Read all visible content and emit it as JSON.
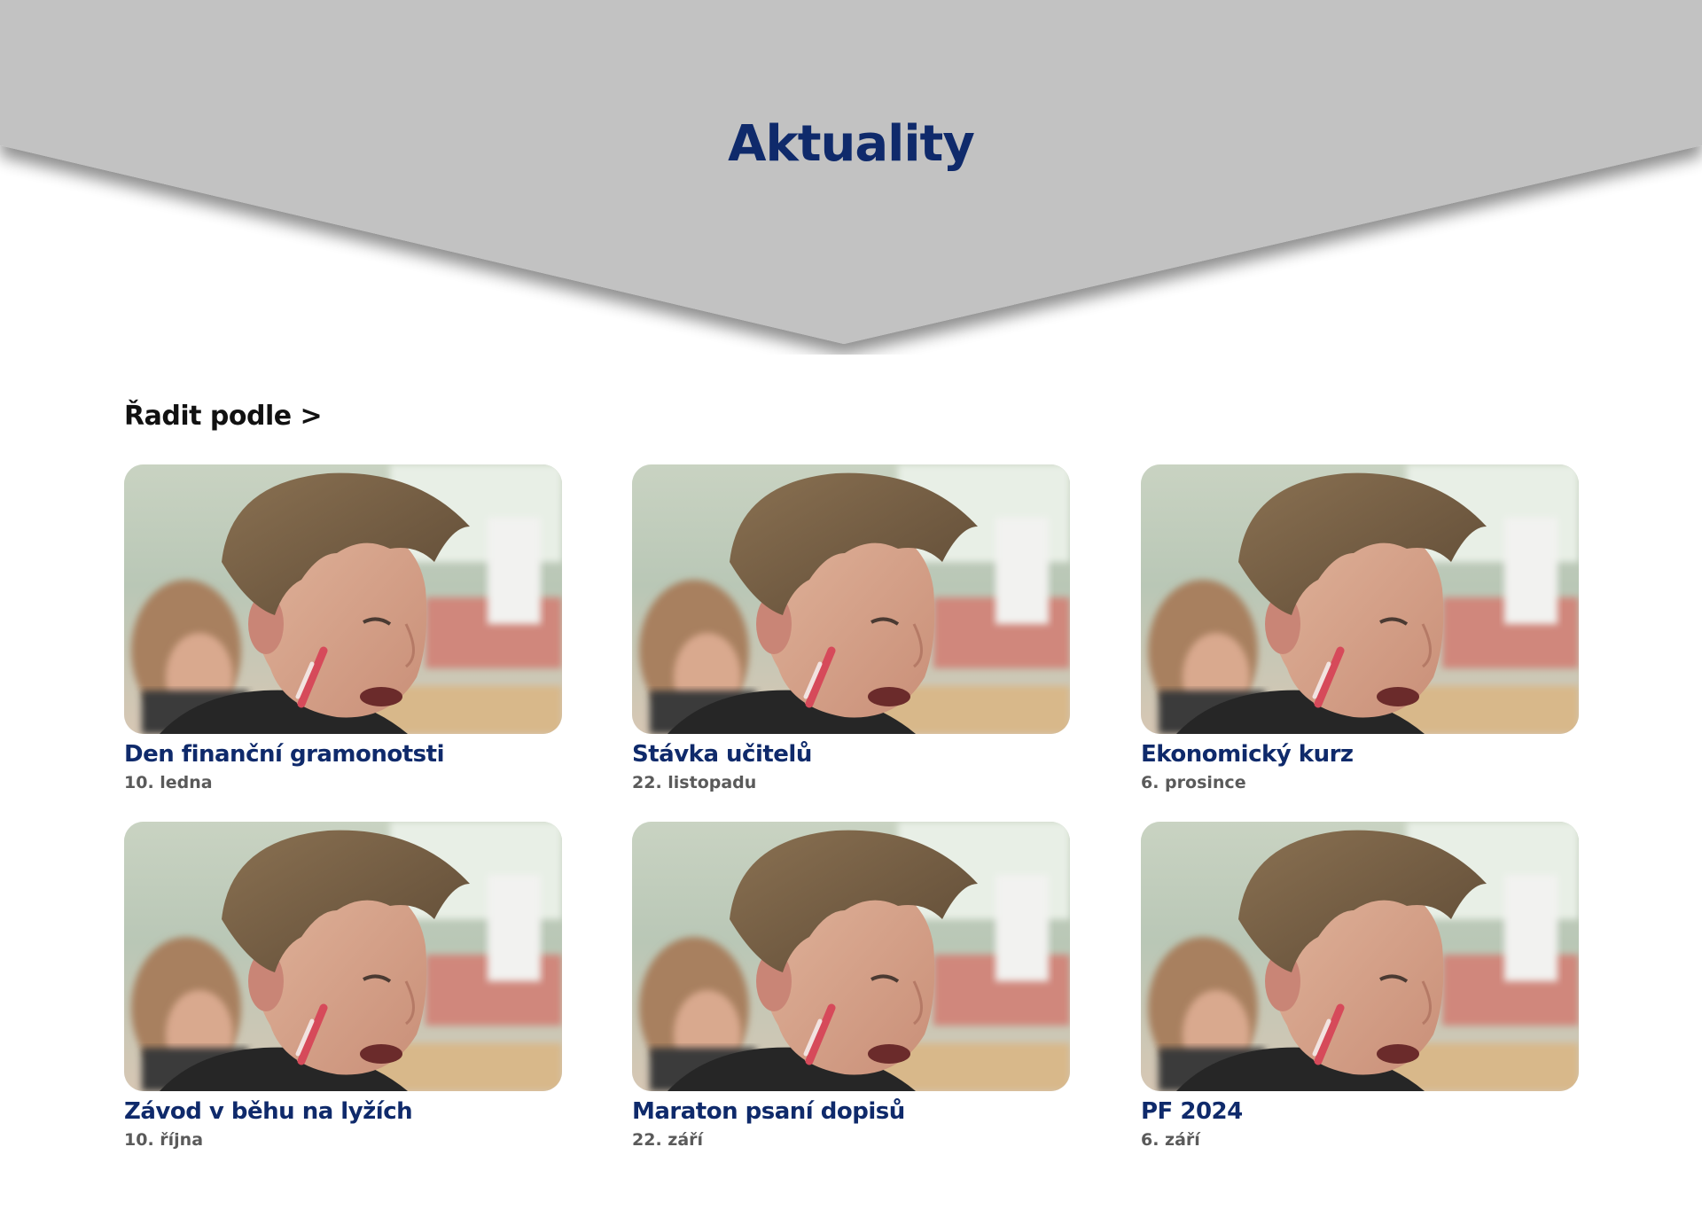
{
  "header": {
    "title": "Aktuality"
  },
  "sort": {
    "label": "Řadit podle >"
  },
  "articles": [
    {
      "title": "Den finanční gramonotsti",
      "date": "10. ledna"
    },
    {
      "title": "Stávka učitelů",
      "date": "22. listopadu"
    },
    {
      "title": "Ekonomický kurz",
      "date": "6. prosince"
    },
    {
      "title": "Závod v běhu na lyžích",
      "date": "10. října"
    },
    {
      "title": "Maraton psaní dopisů",
      "date": "22. září"
    },
    {
      "title": "PF 2024",
      "date": "6. září"
    }
  ],
  "colors": {
    "hero_gray": "#c2c2c2",
    "title_blue": "#0f2a6b",
    "date_gray": "#5a5a5a"
  },
  "icons": {
    "article_image": "photo-of-boy"
  }
}
